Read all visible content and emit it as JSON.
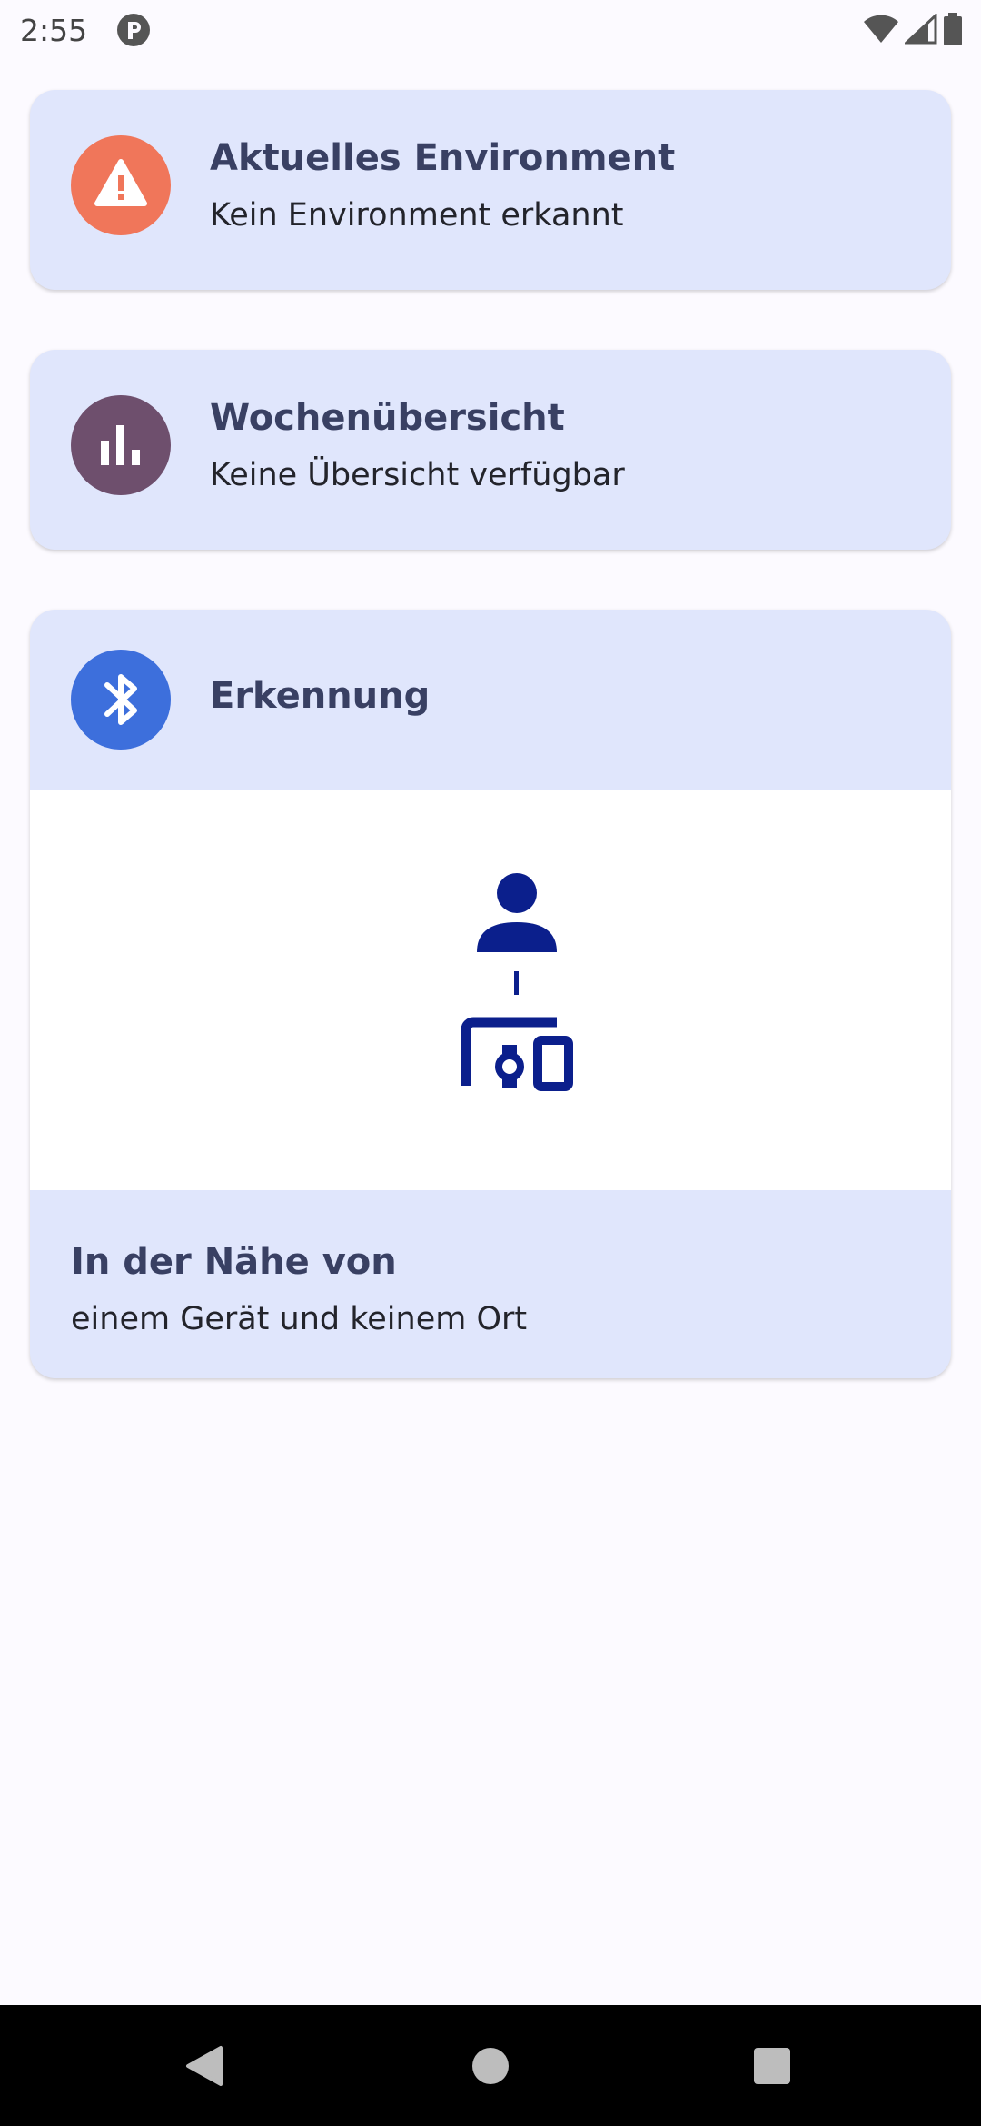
{
  "status_bar": {
    "time": "2:55"
  },
  "cards": [
    {
      "title": "Aktuelles Environment",
      "subtitle": "Kein Environment erkannt",
      "icon": "warning-icon",
      "icon_color": "#f0765a"
    },
    {
      "title": "Wochenübersicht",
      "subtitle": "Keine Übersicht verfügbar",
      "icon": "bar-chart-icon",
      "icon_color": "#6e4f6d"
    }
  ],
  "detection": {
    "title": "Erkennung",
    "icon": "bluetooth-icon",
    "icon_color": "#3d6fdc",
    "illustration": "person-devices-icon",
    "illustration_color": "#0b1f8c",
    "nearby_title": "In der Nähe von",
    "nearby_text": "einem Gerät und keinem Ort"
  },
  "colors": {
    "card_background": "#e0e6fc",
    "title_text": "#394063",
    "page_background": "#fcfaff"
  },
  "nav": {
    "back": "back-icon",
    "home": "home-icon",
    "recents": "recents-icon"
  }
}
